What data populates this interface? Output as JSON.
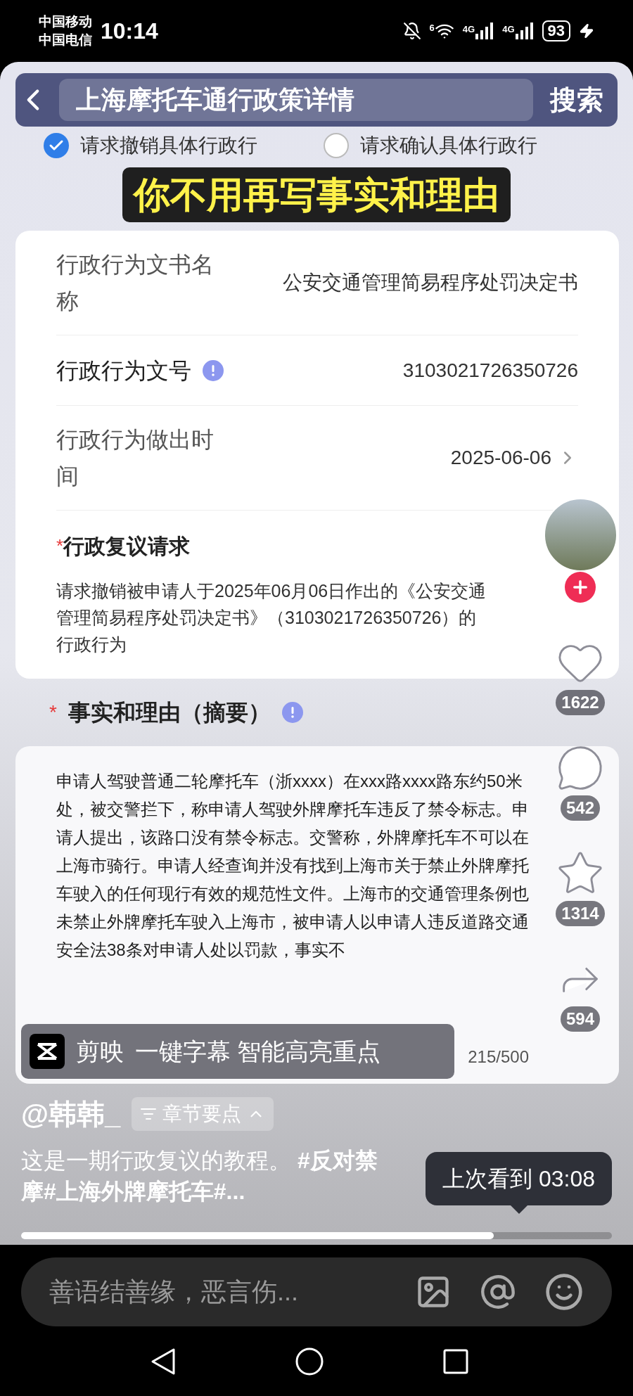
{
  "status_bar": {
    "carriers": [
      "中国移动",
      "中国电信"
    ],
    "time": "10:14",
    "wifi_label": "6",
    "network_labels": [
      "4G",
      "4G"
    ],
    "battery": "93"
  },
  "search": {
    "query": "上海摩托车通行政策详情",
    "button": "搜索"
  },
  "form_options": [
    {
      "label": "请求撤销具体行政行",
      "checked": true
    },
    {
      "label": "请求确认具体行政行",
      "checked": false
    }
  ],
  "caption": "你不用再写事实和理由",
  "form_fields": [
    {
      "label": "行政行为文书名称",
      "value": "公安交通管理简易程序处罚决定书",
      "kind": "text"
    },
    {
      "label": "行政行为文号",
      "value": "3103021726350726",
      "kind": "info"
    },
    {
      "label": "行政行为做出时间",
      "value": "2025-06-06",
      "kind": "picker"
    }
  ],
  "request": {
    "required_mark": "*",
    "title": "行政复议请求",
    "text": "请求撤销被申请人于2025年06月06日作出的《公安交通管理简易程序处罚决定书》（3103021726350726）的行政行为"
  },
  "facts": {
    "required_mark": "*",
    "title": "事实和理由（摘要）",
    "text": "申请人驾驶普通二轮摩托车（浙xxxx）在xxx路xxxx路东约50米处，被交警拦下，称申请人驾驶外牌摩托车违反了禁令标志。申请人提出，该路口没有禁令标志。交警称，外牌摩托车不可以在上海市骑行。申请人经查询并没有找到上海市关于禁止外牌摩托车驶入的任何现行有效的规范性文件。上海市的交通管理条例也未禁止外牌摩托车驶入上海市，被申请人以申请人违反道路交通安全法38条对申请人处以罚款，事实不",
    "counter": "215/500"
  },
  "actions": [
    {
      "kind": "like",
      "count": "1622"
    },
    {
      "kind": "comment",
      "count": "542"
    },
    {
      "kind": "favorite",
      "count": "1314"
    },
    {
      "kind": "share",
      "count": "594"
    }
  ],
  "banner": {
    "app": "剪映",
    "text": "一键字幕 智能高亮重点"
  },
  "author": "@韩韩_",
  "chapter_chip": "章节要点",
  "description": "这是一期行政复议的教程。 **#反对禁摩#上海外牌摩托车#...**",
  "resume_tip": "上次看到 03:08",
  "progress": {
    "level": 0.8
  },
  "comment_bar": {
    "placeholder": "善语结善缘，恶言伤..."
  }
}
